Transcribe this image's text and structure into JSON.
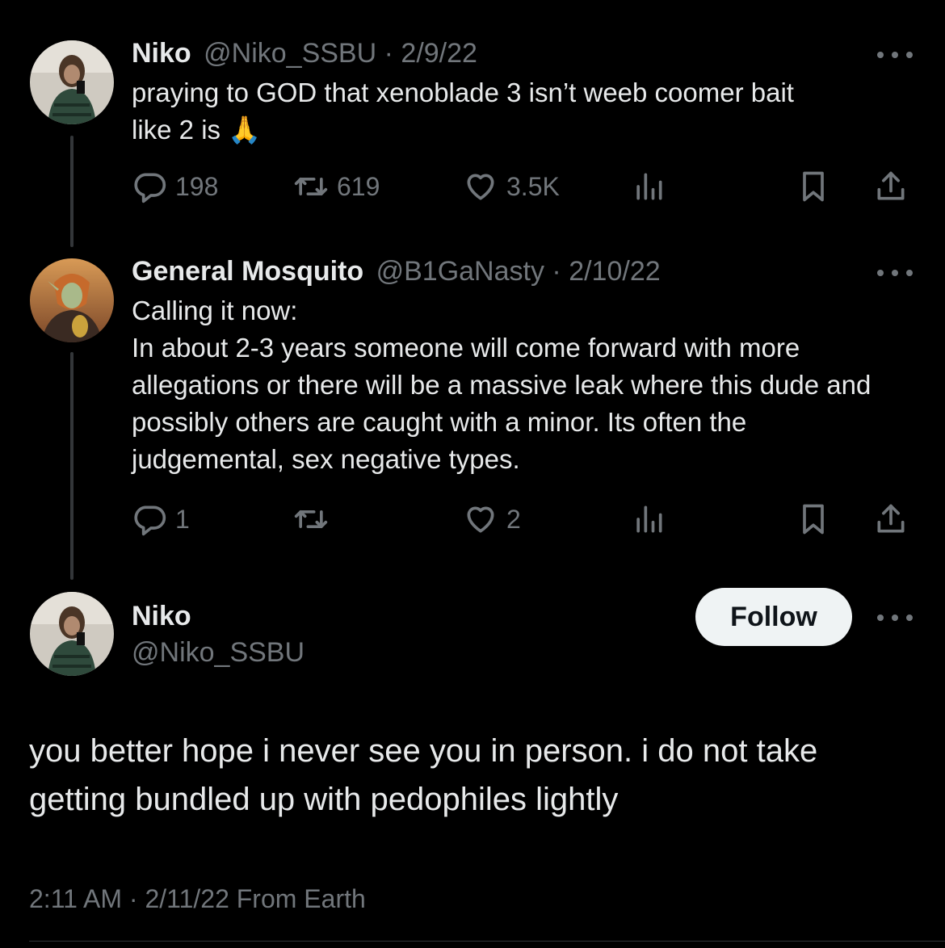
{
  "tweets": [
    {
      "name": "Niko",
      "handle": "@Niko_SSBU",
      "date": "2/9/22",
      "text_lines": [
        "praying to GOD that xenoblade 3 isn’t weeb coomer bait",
        "like 2 is 🙏"
      ],
      "replies": "198",
      "retweets": "619",
      "likes": "3.5K"
    },
    {
      "name": "General Mosquito",
      "handle": "@B1GaNasty",
      "date": "2/10/22",
      "text_lines": [
        "Calling it now:",
        "In about 2-3 years someone will come forward with more allegations or there will be a massive leak where this dude and possibly others are caught with a minor. Its often the judgemental, sex negative types."
      ],
      "replies": "1",
      "retweets": "",
      "likes": "2"
    }
  ],
  "main_tweet": {
    "name": "Niko",
    "handle": "@Niko_SSBU",
    "follow_label": "Follow",
    "text": "you better hope i never see you in person. i do not take getting bundled up with pedophiles lightly",
    "time": "2:11 AM",
    "date": "2/11/22",
    "source": "From Earth"
  },
  "separator": "·",
  "icons": [
    "reply-icon",
    "retweet-icon",
    "like-icon",
    "views-icon",
    "bookmark-icon",
    "share-icon",
    "more-icon"
  ],
  "colors": {
    "background": "#000000",
    "text": "#e7e9ea",
    "muted": "#71767b",
    "follow_bg": "#eff3f4"
  }
}
